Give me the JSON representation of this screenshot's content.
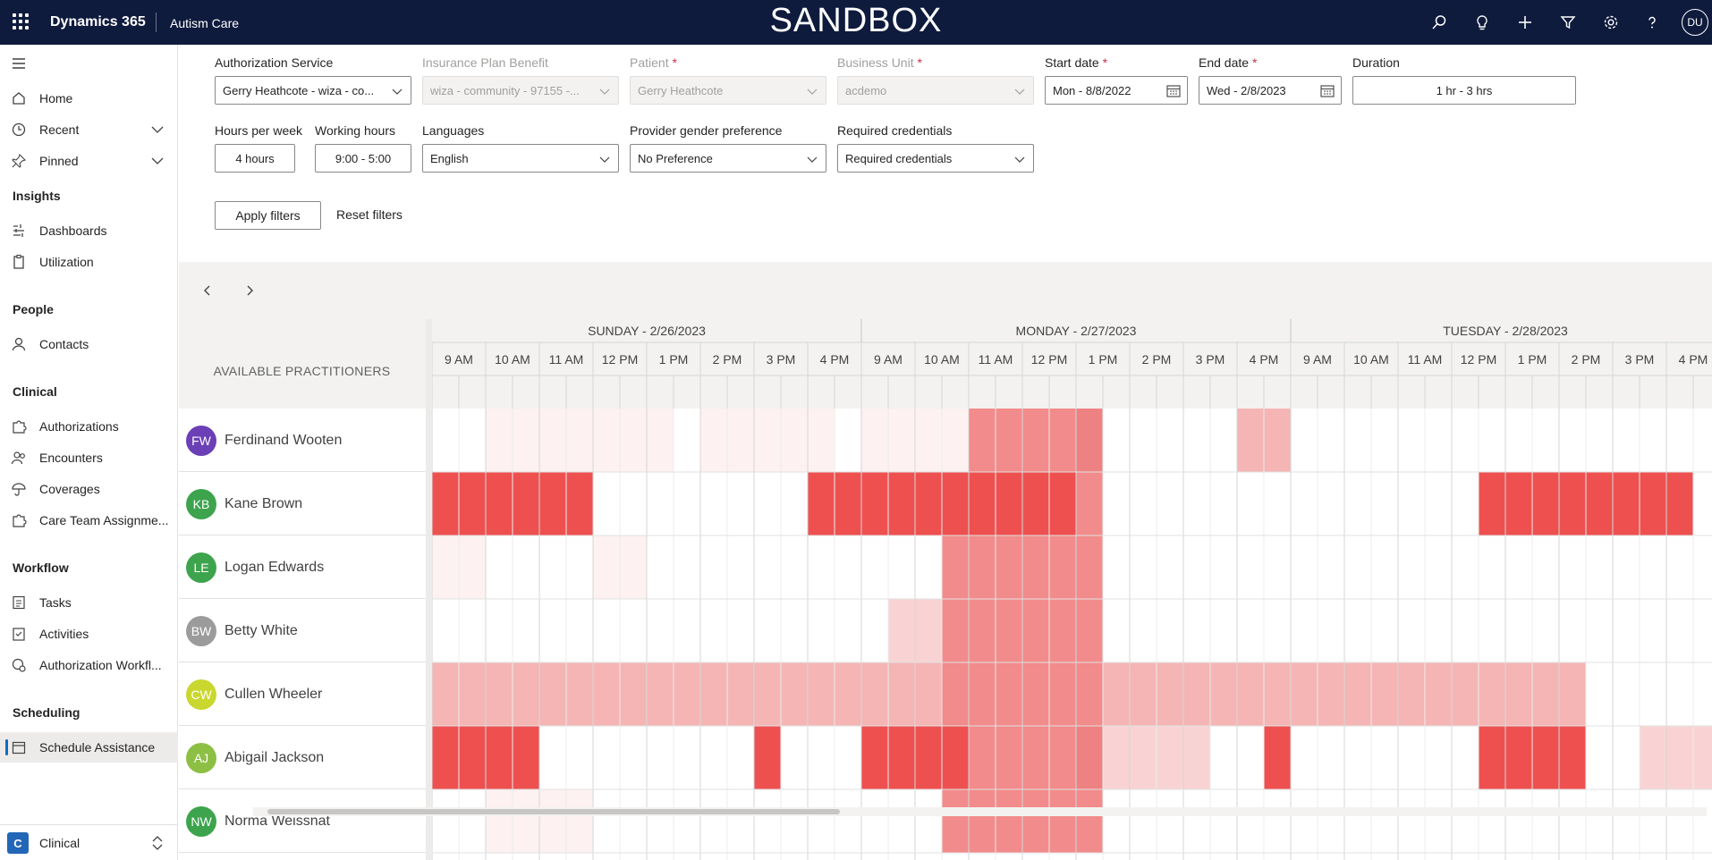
{
  "topbar": {
    "brand": "Dynamics 365",
    "app_name": "Autism Care",
    "environment": "SANDBOX",
    "user_initials": "DU",
    "icons": [
      "search-icon",
      "lightbulb-icon",
      "plus-icon",
      "filter-icon",
      "settings-icon",
      "help-icon"
    ]
  },
  "sidebar": {
    "items": [
      {
        "label": "Home",
        "icon": "home-icon"
      },
      {
        "label": "Recent",
        "icon": "clock-icon"
      },
      {
        "label": "Pinned",
        "icon": "pin-icon"
      }
    ],
    "groups": [
      {
        "title": "Insights",
        "items": [
          {
            "label": "Dashboards",
            "icon": "dashboard-icon"
          },
          {
            "label": "Utilization",
            "icon": "clipboard-icon"
          }
        ]
      },
      {
        "title": "People",
        "items": [
          {
            "label": "Contacts",
            "icon": "person-icon"
          }
        ]
      },
      {
        "title": "Clinical",
        "items": [
          {
            "label": "Authorizations",
            "icon": "puzzle-icon"
          },
          {
            "label": "Encounters",
            "icon": "people-icon"
          },
          {
            "label": "Coverages",
            "icon": "umbrella-icon"
          },
          {
            "label": "Care Team Assignme...",
            "icon": "puzzle-icon"
          }
        ]
      },
      {
        "title": "Workflow",
        "items": [
          {
            "label": "Tasks",
            "icon": "task-icon"
          },
          {
            "label": "Activities",
            "icon": "activities-icon"
          },
          {
            "label": "Authorization Workfl...",
            "icon": "workflow-icon"
          }
        ]
      },
      {
        "title": "Scheduling",
        "items": [
          {
            "label": "Schedule Assistance",
            "icon": "calendar-icon"
          }
        ]
      }
    ],
    "area": {
      "badge": "C",
      "label": "Clinical"
    }
  },
  "filters": {
    "authorization_service": {
      "label": "Authorization Service",
      "value": "Gerry Heathcote - wiza - co..."
    },
    "insurance_plan_benefit": {
      "label": "Insurance Plan Benefit",
      "value": "wiza - community - 97155 -..."
    },
    "patient": {
      "label": "Patient",
      "required": "*",
      "value": "Gerry Heathcote"
    },
    "business_unit": {
      "label": "Business Unit",
      "required": "*",
      "value": "acdemo"
    },
    "start_date": {
      "label": "Start date",
      "required": "*",
      "value": "Mon - 8/8/2022"
    },
    "end_date": {
      "label": "End date",
      "required": "*",
      "value": "Wed - 2/8/2023"
    },
    "duration": {
      "label": "Duration",
      "value": "1 hr - 3 hrs"
    },
    "hours_per_week": {
      "label": "Hours per week",
      "value": "4 hours"
    },
    "working_hours": {
      "label": "Working hours",
      "value": "9:00 - 5:00"
    },
    "languages": {
      "label": "Languages",
      "value": "English"
    },
    "gender_pref": {
      "label": "Provider gender preference",
      "value": "No Preference"
    },
    "credentials": {
      "label": "Required credentials",
      "value": "Required credentials"
    },
    "apply_label": "Apply filters",
    "reset_label": "Reset filters"
  },
  "schedule": {
    "practitioners_header": "AVAILABLE PRACTITIONERS",
    "days": [
      "SUNDAY - 2/26/2023",
      "MONDAY - 2/27/2023",
      "TUESDAY - 2/28/2023"
    ],
    "hours": [
      "9 AM",
      "10 AM",
      "11 AM",
      "12 PM",
      "1 PM",
      "2 PM",
      "3 PM",
      "4 PM"
    ],
    "heat_colors": {
      "0": "#ffffff",
      "1": "#fdf1f1",
      "2": "#f9d3d3",
      "3": "#f5b5b5",
      "4": "#f28b8b",
      "5": "#ee8282",
      "6": "#ee5050"
    },
    "practitioners": [
      {
        "initials": "FW",
        "name": "Ferdinand Wooten",
        "color": "#6b3fb6",
        "cells": [
          0,
          0,
          1,
          1,
          1,
          1,
          1,
          1,
          1,
          0,
          1,
          1,
          1,
          1,
          1,
          0,
          1,
          1,
          1,
          1,
          4,
          4,
          4,
          4,
          5,
          0,
          0,
          0,
          0,
          0,
          3,
          3,
          0,
          0,
          0,
          0,
          0,
          0,
          0,
          0,
          0,
          0,
          0,
          0,
          0,
          0,
          0,
          0,
          0,
          0,
          0,
          3,
          3,
          0,
          0,
          0,
          0,
          0
        ]
      },
      {
        "initials": "KB",
        "name": "Kane Brown",
        "color": "#3da44d",
        "cells": [
          6,
          6,
          6,
          6,
          6,
          6,
          0,
          0,
          0,
          0,
          0,
          0,
          0,
          0,
          6,
          6,
          6,
          6,
          6,
          6,
          6,
          6,
          6,
          6,
          4,
          0,
          0,
          0,
          0,
          0,
          0,
          0,
          0,
          0,
          0,
          0,
          0,
          0,
          0,
          6,
          6,
          6,
          6,
          6,
          6,
          6,
          6,
          0,
          0,
          0,
          0,
          0,
          0,
          0,
          0,
          0,
          6,
          6
        ]
      },
      {
        "initials": "LE",
        "name": "Logan Edwards",
        "color": "#3da44d",
        "cells": [
          1,
          1,
          0,
          0,
          0,
          0,
          1,
          1,
          0,
          0,
          0,
          0,
          0,
          0,
          0,
          0,
          0,
          0,
          0,
          4,
          4,
          4,
          4,
          4,
          4,
          0,
          0,
          0,
          0,
          0,
          0,
          0,
          0,
          0,
          0,
          0,
          0,
          0,
          0,
          0,
          0,
          0,
          0,
          0,
          0,
          0,
          0,
          0,
          0,
          0,
          0,
          0,
          0,
          0,
          0,
          0,
          0,
          0
        ]
      },
      {
        "initials": "BW",
        "name": "Betty White",
        "color": "#9b9b9b",
        "cells": [
          0,
          0,
          0,
          0,
          0,
          0,
          0,
          0,
          0,
          0,
          0,
          0,
          0,
          0,
          0,
          0,
          0,
          2,
          2,
          4,
          4,
          4,
          4,
          4,
          4,
          0,
          0,
          0,
          0,
          0,
          0,
          0,
          0,
          0,
          0,
          0,
          0,
          0,
          0,
          0,
          0,
          0,
          0,
          0,
          0,
          0,
          0,
          0,
          0,
          0,
          0,
          0,
          0,
          0,
          0,
          0,
          0,
          0
        ]
      },
      {
        "initials": "CW",
        "name": "Cullen Wheeler",
        "color": "#c9d72e",
        "cells": [
          3,
          3,
          3,
          3,
          3,
          3,
          3,
          3,
          3,
          3,
          3,
          3,
          3,
          3,
          3,
          3,
          3,
          3,
          3,
          4,
          4,
          4,
          4,
          4,
          4,
          3,
          3,
          3,
          3,
          3,
          3,
          3,
          3,
          3,
          3,
          3,
          3,
          3,
          3,
          3,
          3,
          3,
          3,
          0,
          0,
          0,
          0,
          0,
          0,
          0,
          0,
          0,
          0,
          0,
          0,
          0,
          0,
          0
        ]
      },
      {
        "initials": "AJ",
        "name": "Abigail Jackson",
        "color": "#8cbf44",
        "cells": [
          6,
          6,
          6,
          6,
          0,
          0,
          0,
          0,
          0,
          0,
          0,
          0,
          6,
          0,
          0,
          0,
          6,
          6,
          6,
          6,
          4,
          4,
          4,
          4,
          5,
          2,
          2,
          2,
          2,
          0,
          0,
          6,
          0,
          0,
          0,
          0,
          0,
          0,
          0,
          6,
          6,
          6,
          6,
          0,
          0,
          2,
          2,
          2,
          2,
          0,
          0,
          6,
          0,
          0,
          0,
          0,
          0,
          0
        ]
      },
      {
        "initials": "NW",
        "name": "Norma Weissnat",
        "color": "#3da44d",
        "cells": [
          0,
          0,
          1,
          1,
          1,
          1,
          0,
          0,
          0,
          0,
          0,
          0,
          0,
          0,
          0,
          0,
          0,
          0,
          0,
          4,
          4,
          4,
          4,
          4,
          4,
          0,
          0,
          0,
          0,
          0,
          0,
          0,
          0,
          0,
          0,
          0,
          0,
          0,
          0,
          0,
          0,
          0,
          0,
          0,
          0,
          0,
          0,
          0,
          0,
          0,
          0,
          0,
          0,
          0,
          0,
          0,
          0,
          0
        ]
      }
    ]
  }
}
